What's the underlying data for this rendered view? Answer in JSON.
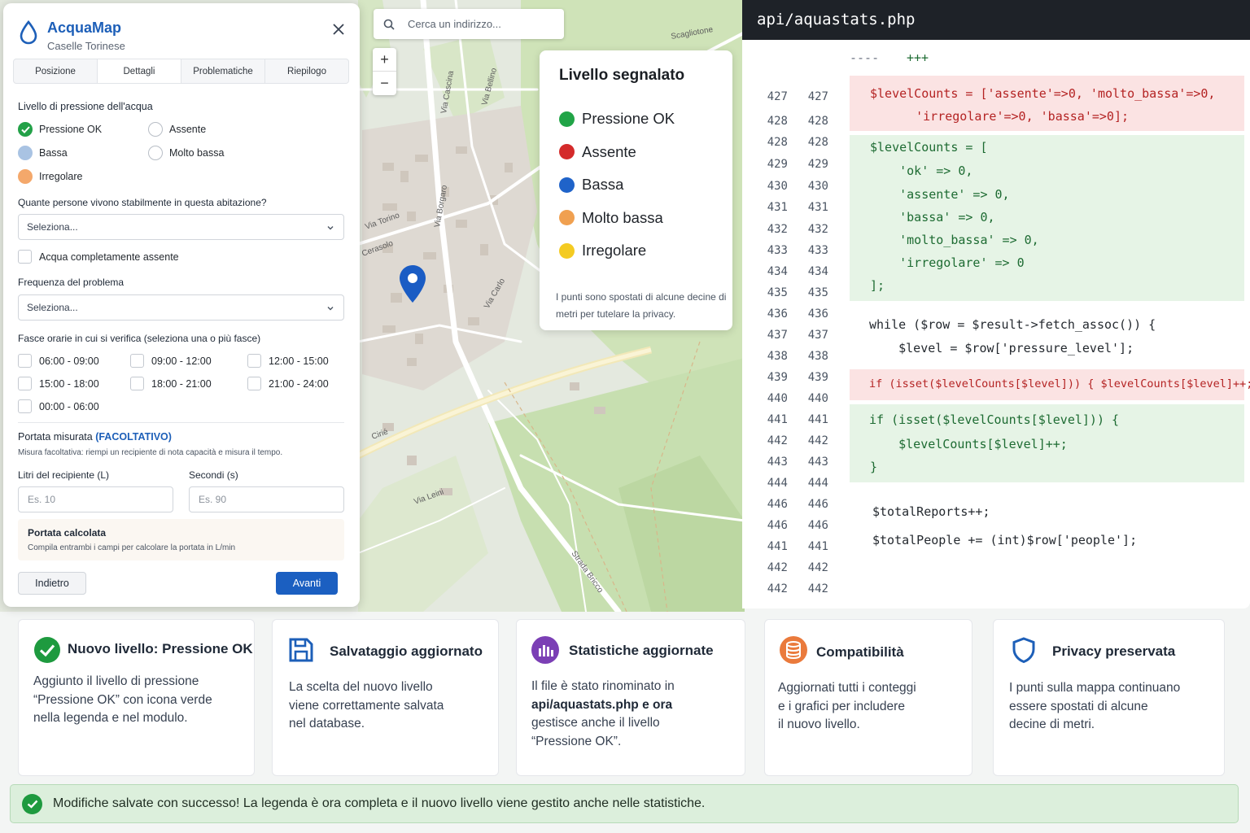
{
  "map": {
    "search_placeholder": "Cerca un indirizzo...",
    "zoom_in": "+",
    "zoom_out": "−",
    "legend": {
      "title": "Livello segnalato",
      "items": [
        {
          "label": "Pressione OK",
          "color": "#21a447"
        },
        {
          "label": "Assente",
          "color": "#d42a2a"
        },
        {
          "label": "Bassa",
          "color": "#1f63c9"
        },
        {
          "label": "Molto bassa",
          "color": "#f0a050"
        },
        {
          "label": "Irregolare",
          "color": "#f4cb22"
        }
      ],
      "note": "I punti sono spostati di alcune decine di metri per tutelare la privacy."
    },
    "street_labels": [
      "Scagliotone",
      "Via Cascina",
      "Cerasolo",
      "Via Torino",
      "Cirié",
      "Via Borgaro",
      "Via Bellino",
      "Via Leini",
      "Via Carlo",
      "Strada Bricco"
    ]
  },
  "form": {
    "app_title": "AcquaMap",
    "app_subtitle": "Caselle Torinese",
    "tabs": [
      "Posizione",
      "Dettagli",
      "Problematiche",
      "Riepilogo"
    ],
    "active_tab": "Dettagli",
    "pressure_label": "Livello di pressione dell'acqua",
    "pressure_options": [
      "Pressione OK",
      "Assente",
      "Bassa",
      "Molto bassa",
      "Irregolare"
    ],
    "pressure_selected": "Pressione OK",
    "people_label": "Quante persone vivono stabilmente in questa abitazione?",
    "people_select": "Seleziona...",
    "absent_check": "Acqua completamente assente",
    "frequency_label": "Frequenza del problema",
    "frequency_select": "Seleziona...",
    "slots_label": "Fasce orarie in cui si verifica",
    "slots_hint": "(seleziona una o più fasce)",
    "slots": [
      "06:00 - 09:00",
      "09:00 - 12:00",
      "12:00 - 15:00",
      "15:00 - 18:00",
      "18:00 - 21:00",
      "21:00 - 24:00",
      "00:00 - 06:00"
    ],
    "flow_label": "Portata misurata",
    "flow_optional": "(FACOLTATIVO)",
    "flow_hint": "Misura facoltativa: riempi un recipiente di nota capacità e misura il tempo.",
    "liters_label": "Litri del recipiente (L)",
    "liters_placeholder": "Es. 10",
    "seconds_label": "Secondi (s)",
    "seconds_placeholder": "Es. 90",
    "calc_title": "Portata calcolata",
    "calc_hint": "Compila entrambi i campi per calcolare la portata in L/min",
    "back_button": "Indietro",
    "next_button": "Avanti"
  },
  "code": {
    "file": "api/aquastats.php",
    "line_numbers": [
      "427",
      "428",
      "428",
      "429",
      "430",
      "431",
      "432",
      "433",
      "434",
      "435",
      "436",
      "437",
      "438",
      "439",
      "440",
      "441",
      "442",
      "443",
      "444",
      "446",
      "446",
      "441",
      "442",
      "442"
    ],
    "header_marker": "----",
    "header_plus": "+++",
    "lines": [
      {
        "text": "$levelCounts = ['assente'=>0, 'molto_bassa'=>0,",
        "kind": "del"
      },
      {
        "text": "    'irregolare'=>0, 'bassa'=>0];",
        "kind": "del"
      },
      {
        "text": "$levelCounts = [",
        "kind": "add"
      },
      {
        "text": "    'ok' => 0,",
        "kind": "add"
      },
      {
        "text": "    'assente' => 0,",
        "kind": "add"
      },
      {
        "text": "    'bassa' => 0,",
        "kind": "add"
      },
      {
        "text": "    'molto_bassa' => 0,",
        "kind": "add"
      },
      {
        "text": "    'irregolare' => 0",
        "kind": "add"
      },
      {
        "text": "];",
        "kind": "add"
      },
      {
        "text": "while ($row = $result->fetch_assoc()) {",
        "kind": "ctx"
      },
      {
        "text": "    $level = $row['pressure_level'];",
        "kind": "ctx"
      },
      {
        "text": "if (isset($levelCounts[$level])) { $levelCounts[$level]++; }",
        "kind": "del"
      },
      {
        "text": "if (isset($levelCounts[$level])) {",
        "kind": "add"
      },
      {
        "text": "    $levelCounts[$level]++;",
        "kind": "add"
      },
      {
        "text": "}",
        "kind": "add"
      },
      {
        "text": "$totalReports++;",
        "kind": "ctx"
      },
      {
        "text": "$totalPeople += (int)$row['people'];",
        "kind": "ctx"
      }
    ]
  },
  "cards": [
    {
      "title": "Nuovo livello: Pressione OK",
      "icon": "check-circle-icon",
      "lines": [
        "Aggiunto il livello di pressione",
        "“Pressione OK” con icona verde",
        "nella legenda e nel modulo."
      ]
    },
    {
      "title": "Salvataggio aggiornato",
      "icon": "floppy-disk-icon",
      "lines": [
        "La scelta del nuovo livello",
        "viene correttamente salvata",
        "nel database."
      ]
    },
    {
      "title": "Statistiche aggiornate",
      "icon": "bar-chart-icon",
      "lines": [
        "Il file è stato rinominato in",
        "api/aquastats.php e ora",
        "gestisce anche il livello",
        "“Pressione OK”."
      ]
    },
    {
      "title": "Compatibilità",
      "icon": "database-icon",
      "lines": [
        "Aggiornati tutti i conteggi",
        "e i grafici per includere",
        "il nuovo livello."
      ]
    },
    {
      "title": "Privacy preservata",
      "icon": "shield-icon",
      "lines": [
        "I punti sulla mappa continuano",
        "essere spostati di alcune",
        "decine di metri."
      ]
    }
  ],
  "banner": {
    "message": "Modifiche salvate con successo! La legenda è ora completa e il nuovo livello viene gestito anche nelle statistiche."
  }
}
